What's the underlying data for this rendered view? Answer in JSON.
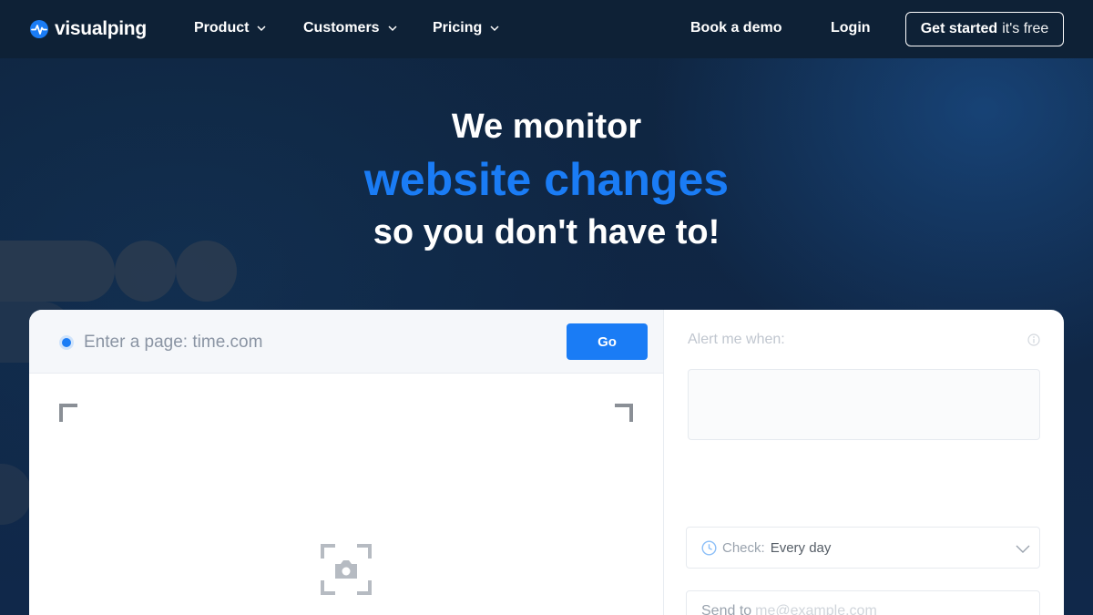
{
  "nav": {
    "logo_text": "visualping",
    "items": [
      {
        "label": "Product"
      },
      {
        "label": "Customers"
      },
      {
        "label": "Pricing"
      }
    ],
    "book_demo": "Book a demo",
    "login": "Login",
    "cta_strong": "Get started",
    "cta_light": "it's free"
  },
  "hero": {
    "line1": "We monitor",
    "line2": "website changes",
    "line3": "so you don't have to!"
  },
  "form": {
    "url_placeholder": "Enter a page: time.com",
    "go_label": "Go",
    "alert_label": "Alert me when:",
    "check_label": "Check:",
    "check_value": "Every day",
    "send_label": "Send to",
    "send_placeholder": "me@example.com"
  },
  "colors": {
    "accent": "#1a7cf5",
    "nav_bg": "#0e2136",
    "page_bg": "#0f2540"
  },
  "icons": {
    "logo": "pulse-logo-icon",
    "chevron": "chevron-down-icon",
    "screenshot": "camera-frame-icon",
    "info": "info-icon",
    "clock": "clock-icon"
  }
}
